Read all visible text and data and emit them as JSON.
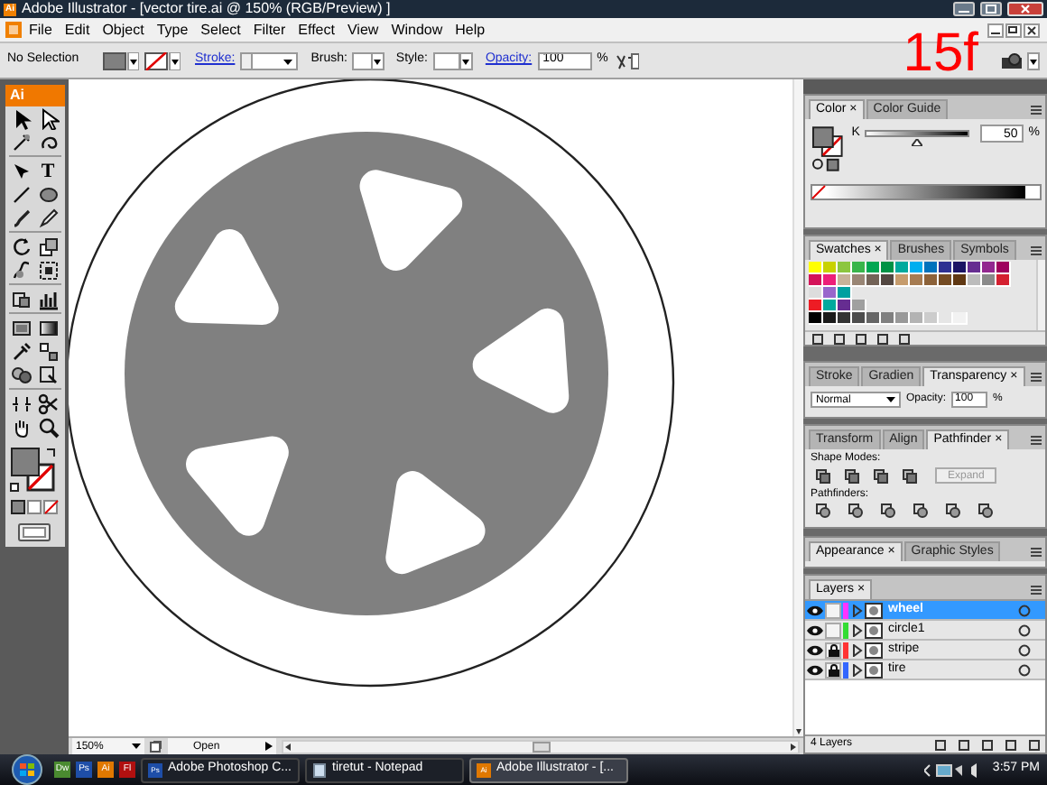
{
  "window": {
    "title": "Adobe Illustrator - [vector tire.ai @ 150% (RGB/Preview) ]",
    "icon_label": "Ai"
  },
  "menu": [
    "File",
    "Edit",
    "Object",
    "Type",
    "Select",
    "Filter",
    "Effect",
    "View",
    "Window",
    "Help"
  ],
  "step_label": "15f",
  "control_bar": {
    "selection": "No Selection",
    "stroke_label": "Stroke:",
    "brush_label": "Brush:",
    "style_label": "Style:",
    "opacity_label": "Opacity:",
    "opacity": "100",
    "opacity_unit": "%"
  },
  "toolbox": {
    "logo": "Ai",
    "type_tool": "T"
  },
  "color_panel": {
    "tabs": [
      {
        "label": "Color",
        "close": "×",
        "selected": true
      },
      {
        "label": "Color Guide",
        "selected": false
      }
    ],
    "channel": "K",
    "level": 0.5,
    "value": "50",
    "unit": "%"
  },
  "swatches_panel": {
    "tabs": [
      {
        "label": "Swatches",
        "close": "×",
        "selected": true
      },
      {
        "label": "Brushes",
        "selected": false
      },
      {
        "label": "Symbols",
        "selected": false
      }
    ],
    "rows": [
      [
        {
          "color": "#ffff00"
        },
        {
          "color": "#c8d200"
        },
        {
          "color": "#8cc63f"
        },
        {
          "color": "#39b54a"
        },
        {
          "color": "#00a651"
        },
        {
          "color": "#009245"
        },
        {
          "color": "#00a99d"
        },
        {
          "color": "#00aeef"
        },
        {
          "color": "#0072bc"
        },
        {
          "color": "#2e3192"
        },
        {
          "color": "#1b1464"
        },
        {
          "color": "#662d91"
        },
        {
          "color": "#92278f"
        },
        {
          "color": "#9e005d"
        }
      ],
      [
        {
          "color": "#d4145a"
        },
        {
          "color": "#ed1e79"
        },
        {
          "color": "#c7b299"
        },
        {
          "color": "#998675"
        },
        {
          "color": "#736357"
        },
        {
          "color": "#534741"
        },
        {
          "color": "#c69c6d"
        },
        {
          "color": "#a67c52"
        },
        {
          "color": "#8c6239"
        },
        {
          "color": "#754c24"
        },
        {
          "color": "#603813"
        },
        {
          "color": "#bcbcbc"
        },
        {
          "color": "#8a8a8a"
        },
        {
          "color": "#d42030"
        }
      ],
      [
        {
          "color": "#dddddd"
        },
        {
          "color": "#9966cc"
        },
        {
          "color": "#00a0a0"
        }
      ],
      [
        {
          "color": "#ed1c24"
        },
        {
          "color": "#00a99d"
        },
        {
          "color": "#662d91"
        },
        {
          "color": "#a0a0a0"
        }
      ],
      [
        {
          "color": "#000000"
        },
        {
          "color": "#1a1a1a"
        },
        {
          "color": "#333333"
        },
        {
          "color": "#4d4d4d"
        },
        {
          "color": "#666666"
        },
        {
          "color": "#808080"
        },
        {
          "color": "#999999"
        },
        {
          "color": "#b3b3b3"
        },
        {
          "color": "#cccccc"
        },
        {
          "color": "#e6e6e6"
        },
        {
          "color": "#f2f2f2"
        }
      ]
    ]
  },
  "transparency_panel": {
    "tabs": [
      {
        "label": "Stroke",
        "selected": false
      },
      {
        "label": "Gradien",
        "selected": false
      },
      {
        "label": "Transparency",
        "close": "×",
        "selected": true
      }
    ],
    "blend_mode": "Normal",
    "opacity_label": "Opacity:",
    "opacity": "100",
    "unit": "%"
  },
  "pathfinder_panel": {
    "tabs": [
      {
        "label": "Transform",
        "selected": false
      },
      {
        "label": "Align",
        "selected": false
      },
      {
        "label": "Pathfinder",
        "close": "×",
        "selected": true
      }
    ],
    "shape_modes_label": "Shape Modes:",
    "expand_button": "Expand",
    "pathfinders_label": "Pathfinders:"
  },
  "appearance_panel": {
    "tabs": [
      {
        "label": "Appearance",
        "close": "×",
        "selected": true
      },
      {
        "label": "Graphic Styles",
        "selected": false
      }
    ]
  },
  "layers_panel": {
    "tabs": [
      {
        "label": "Layers",
        "close": "×",
        "selected": true
      }
    ],
    "layers": [
      {
        "name": "wheel",
        "selected": true,
        "locked": false,
        "color": "#ff33ff"
      },
      {
        "name": "circle1",
        "selected": false,
        "locked": false,
        "color": "#33dd33"
      },
      {
        "name": "stripe",
        "selected": false,
        "locked": true,
        "color": "#ff3333"
      },
      {
        "name": "tire",
        "selected": false,
        "locked": true,
        "color": "#3366ff"
      }
    ],
    "count": "4 Layers"
  },
  "status_bar": {
    "zoom": "150%",
    "status": "Open"
  },
  "taskbar": {
    "quick_launch": [
      "Dw",
      "Ps",
      "Ai",
      "Fl"
    ],
    "buttons": [
      {
        "label": "Adobe Photoshop C...",
        "icon": "Ps",
        "selected": false
      },
      {
        "label": "tiretut - Notepad",
        "selected": false
      },
      {
        "label": "Adobe Illustrator - [...",
        "icon": "Ai",
        "selected": true
      }
    ],
    "clock": "3:57 PM"
  }
}
